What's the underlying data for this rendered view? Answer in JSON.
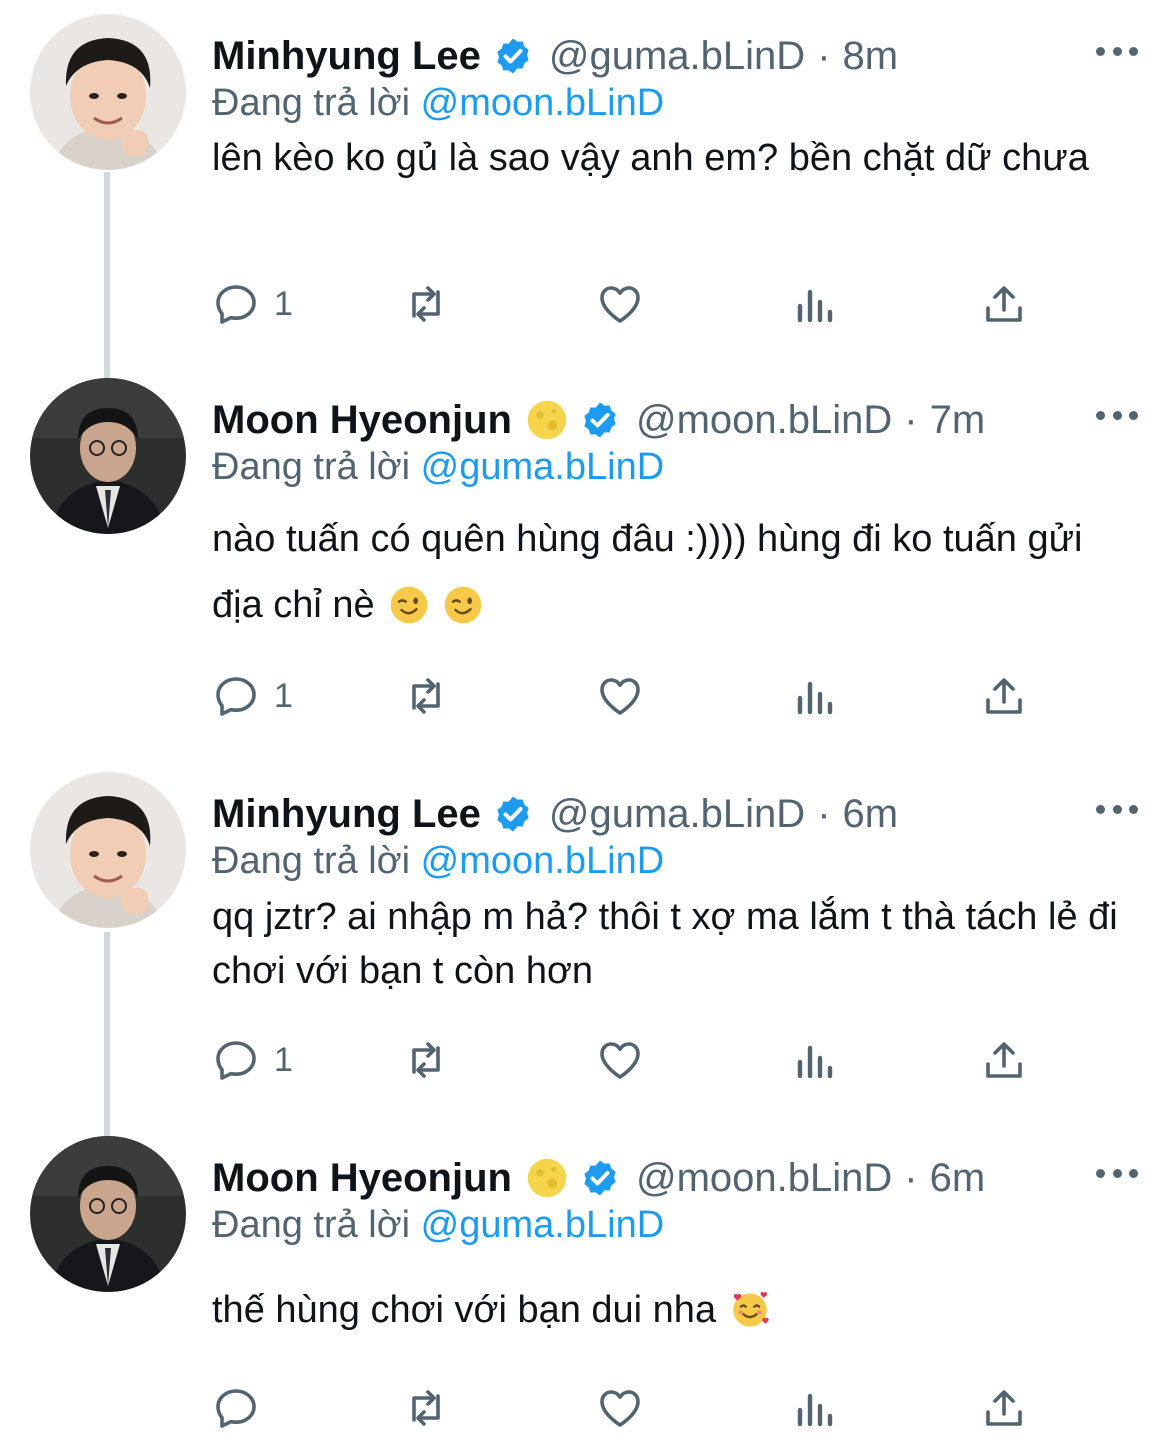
{
  "reply_label": "Đang trả lời",
  "tweets": [
    {
      "author": "Minhyung Lee",
      "handle": "@guma.bLinD",
      "time": "8m",
      "reply_to": "@moon.bLinD",
      "text": "lên kèo ko gủ là sao vậy anh em? bền chặt dữ chưa",
      "reply_count": "1",
      "has_moon_emoji": false,
      "trailing_emoji": []
    },
    {
      "author": "Moon Hyeonjun",
      "handle": "@moon.bLinD",
      "time": "7m",
      "reply_to": "@guma.bLinD",
      "text": "nào tuấn có quên hùng đâu :)))) hùng đi ko tuấn gửi địa chỉ nè",
      "reply_count": "1",
      "has_moon_emoji": true,
      "trailing_emoji": [
        "winking-face",
        "winking-face"
      ]
    },
    {
      "author": "Minhyung Lee",
      "handle": "@guma.bLinD",
      "time": "6m",
      "reply_to": "@moon.bLinD",
      "text": "qq jztr? ai nhập m hả? thôi t xợ ma lắm t thà tách lẻ đi chơi với bạn t còn hơn",
      "reply_count": "1",
      "has_moon_emoji": false,
      "trailing_emoji": []
    },
    {
      "author": "Moon Hyeonjun",
      "handle": "@moon.bLinD",
      "time": "6m",
      "reply_to": "@guma.bLinD",
      "text": "thế hùng chơi với bạn dui nha",
      "reply_count": "",
      "has_moon_emoji": true,
      "trailing_emoji": [
        "smiling-face-with-hearts"
      ]
    }
  ],
  "colors": {
    "text": "#0f1419",
    "secondary": "#536471",
    "link": "#1d9bf0",
    "thread_line": "#cfd9de"
  }
}
